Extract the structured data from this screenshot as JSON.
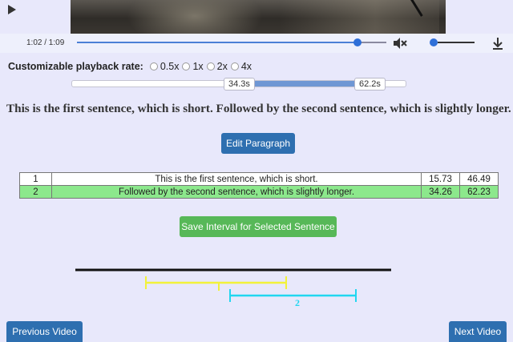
{
  "video": {
    "time_display": "1:02 / 1:09",
    "progress": 0.9,
    "volume": 0.05,
    "muted": true
  },
  "rate": {
    "label": "Customizable playback rate:",
    "options": [
      "0.5x",
      "1x",
      "2x",
      "4x"
    ]
  },
  "interval": {
    "start_label": "34.3s",
    "end_label": "62.2s"
  },
  "paragraph": "This is the first sentence, which is short. Followed by the second sentence, which is slightly longer.",
  "buttons": {
    "edit": "Edit Paragraph",
    "save": "Save Interval for Selected Sentence",
    "prev": "Previous Video",
    "next": "Next Video"
  },
  "sentences": [
    {
      "index": "1",
      "text": "This is the first sentence, which is short.",
      "start": "15.73",
      "end": "46.49",
      "selected": false
    },
    {
      "index": "2",
      "text": "Followed by the second sentence, which is slightly longer.",
      "start": "34.26",
      "end": "62.23",
      "selected": true
    }
  ],
  "timeline": {
    "marker2_label": "2",
    "colors": {
      "main": "#111111",
      "sentence1": "#f2f23a",
      "sentence2": "#22d6f0"
    }
  }
}
